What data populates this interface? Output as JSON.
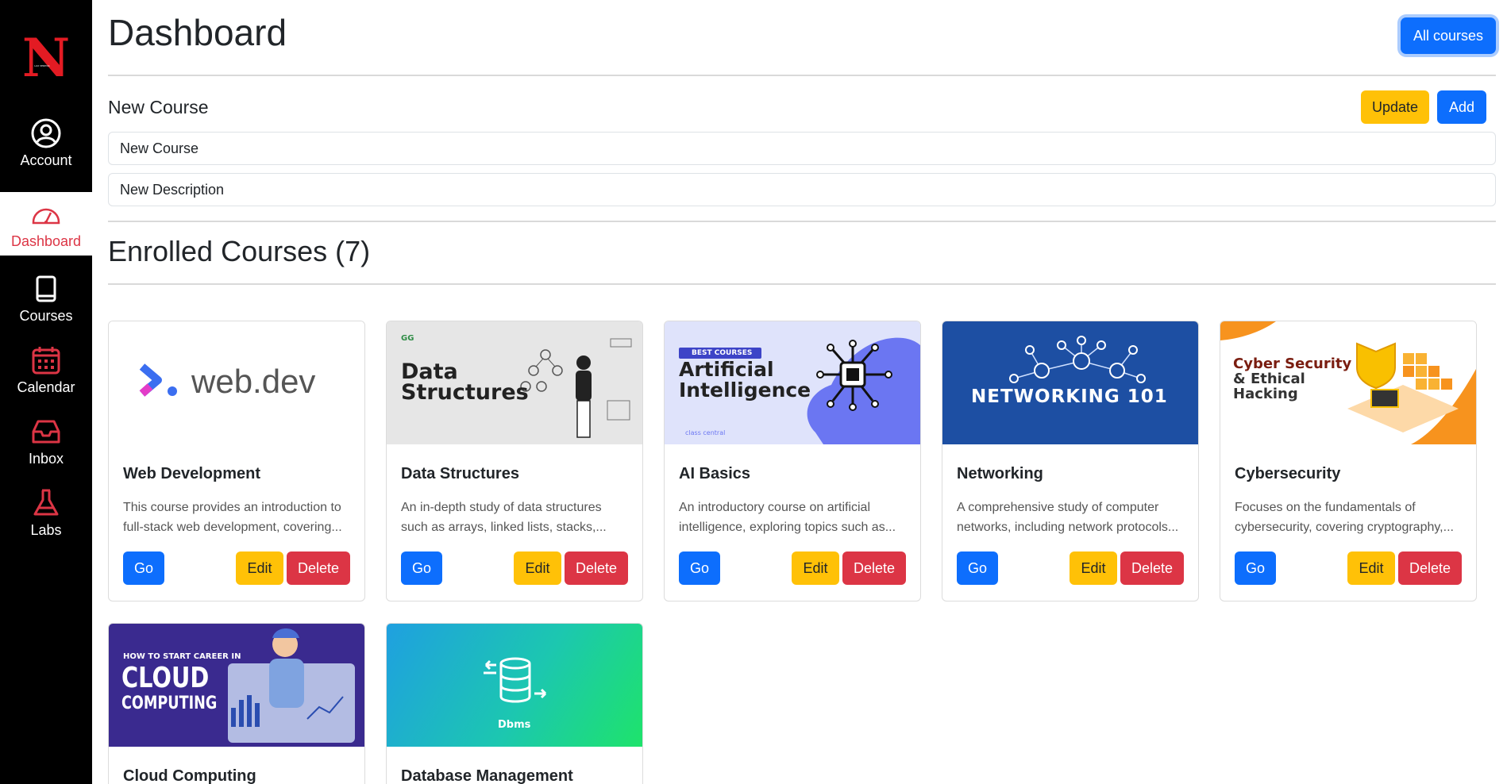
{
  "sidebar": {
    "items": [
      {
        "label": "Account",
        "icon": "account-icon"
      },
      {
        "label": "Dashboard",
        "icon": "dashboard-icon"
      },
      {
        "label": "Courses",
        "icon": "book-icon"
      },
      {
        "label": "Calendar",
        "icon": "calendar-icon"
      },
      {
        "label": "Inbox",
        "icon": "inbox-icon"
      },
      {
        "label": "Labs",
        "icon": "flask-icon"
      }
    ],
    "active": "Dashboard"
  },
  "header": {
    "title": "Dashboard",
    "all_courses_label": "All courses"
  },
  "new_course": {
    "section_title": "New Course",
    "update_label": "Update",
    "add_label": "Add",
    "name_value": "New Course",
    "description_value": "New Description"
  },
  "enrolled": {
    "title": "Enrolled Courses (7)"
  },
  "card_buttons": {
    "go": "Go",
    "edit": "Edit",
    "delete": "Delete"
  },
  "courses": [
    {
      "title": "Web Development",
      "desc1": "This course provides an introduction to",
      "desc2": "full-stack web development, covering...",
      "image_text": "web.dev"
    },
    {
      "title": "Data Structures",
      "desc1": "An in-depth study of data structures",
      "desc2": "such as arrays, linked lists, stacks,...",
      "image_text_1": "Data",
      "image_text_2": "Structures"
    },
    {
      "title": "AI Basics",
      "desc1": "An introductory course on artificial",
      "desc2": "intelligence, exploring topics such as...",
      "image_badge": "BEST COURSES",
      "image_text_1": "Artificial",
      "image_text_2": "Intelligence",
      "image_footer": "class central"
    },
    {
      "title": "Networking",
      "desc1": "A comprehensive study of computer",
      "desc2": "networks, including network protocols...",
      "image_text": "NETWORKING 101"
    },
    {
      "title": "Cybersecurity",
      "desc1": "Focuses on the fundamentals of",
      "desc2": "cybersecurity, covering cryptography,...",
      "image_text_1": "Cyber Security",
      "image_text_2": "& Ethical",
      "image_text_3": "Hacking"
    },
    {
      "title": "Cloud Computing",
      "image_text_1": "HOW TO START CAREER IN",
      "image_text_2": "CLOUD",
      "image_text_3": "COMPUTING"
    },
    {
      "title": "Database Management",
      "image_text": "Dbms"
    }
  ],
  "colors": {
    "primary": "#0d6efd",
    "warning": "#ffc107",
    "danger": "#dc3545",
    "sidebar_bg": "#000000"
  }
}
